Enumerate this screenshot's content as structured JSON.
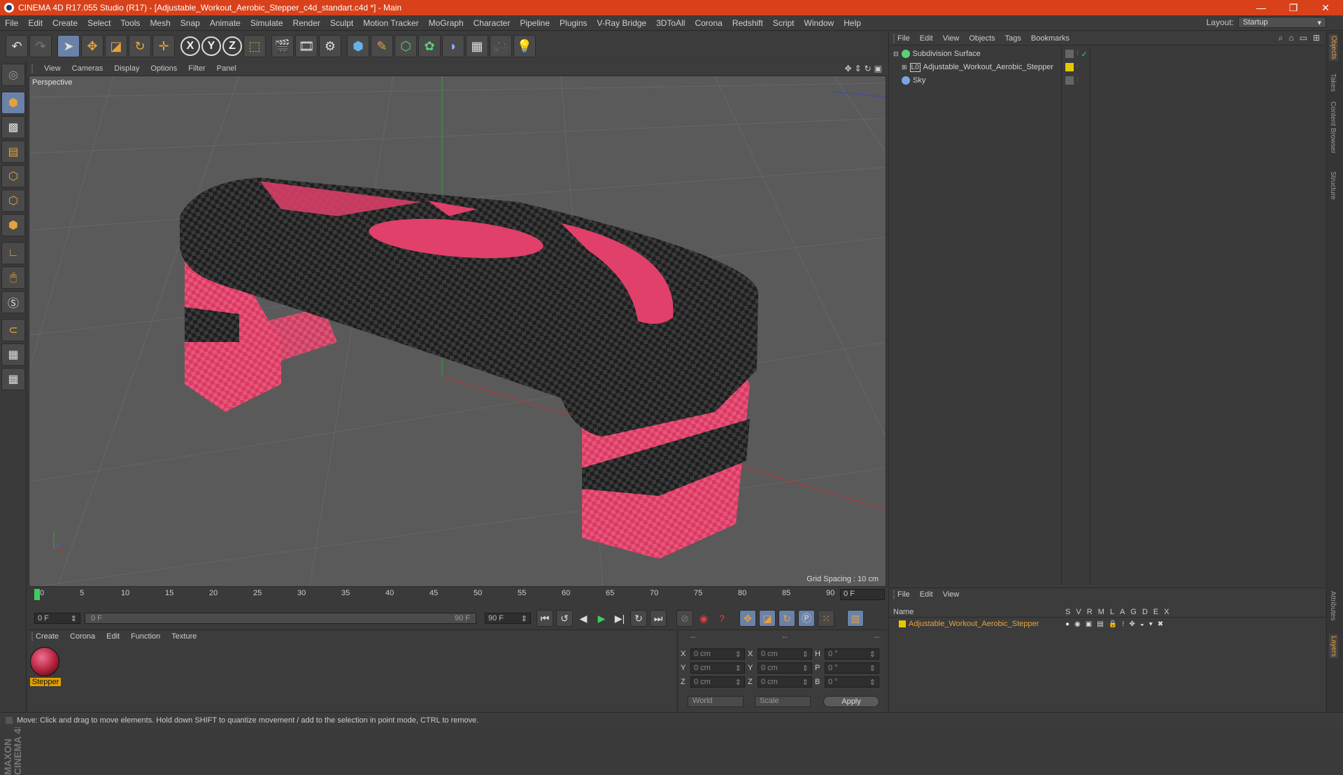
{
  "window": {
    "title": "CINEMA 4D R17.055 Studio (R17) - [Adjustable_Workout_Aerobic_Stepper_c4d_standart.c4d *] - Main",
    "minimize": "—",
    "restore": "❐",
    "close": "✕"
  },
  "menubar": {
    "items": [
      "File",
      "Edit",
      "Create",
      "Select",
      "Tools",
      "Mesh",
      "Snap",
      "Animate",
      "Simulate",
      "Render",
      "Sculpt",
      "Motion Tracker",
      "MoGraph",
      "Character",
      "Pipeline",
      "Plugins",
      "V-Ray Bridge",
      "3DToAll",
      "Corona",
      "Redshift",
      "Script",
      "Window",
      "Help"
    ],
    "layout_label": "Layout:",
    "layout_value": "Startup"
  },
  "viewport": {
    "menu": [
      "View",
      "Cameras",
      "Display",
      "Options",
      "Filter",
      "Panel"
    ],
    "label": "Perspective",
    "grid_spacing": "Grid Spacing : 10 cm"
  },
  "timeline": {
    "ticks": [
      "0",
      "5",
      "10",
      "15",
      "20",
      "25",
      "30",
      "35",
      "40",
      "45",
      "50",
      "55",
      "60",
      "65",
      "70",
      "75",
      "80",
      "85",
      "90"
    ],
    "current_frame": "0 F",
    "start": "0 F",
    "range_start": "0 F",
    "range_end": "90 F",
    "end": "90 F"
  },
  "materials": {
    "menu": [
      "Create",
      "Corona",
      "Edit",
      "Function",
      "Texture"
    ],
    "items": [
      {
        "name": "Stepper"
      }
    ]
  },
  "coordinates": {
    "headers": [
      "--",
      "--",
      "--"
    ],
    "rows": [
      {
        "a": "X",
        "av": "0 cm",
        "b": "X",
        "bv": "0 cm",
        "c": "H",
        "cv": "0 °"
      },
      {
        "a": "Y",
        "av": "0 cm",
        "b": "Y",
        "bv": "0 cm",
        "c": "P",
        "cv": "0 °"
      },
      {
        "a": "Z",
        "av": "0 cm",
        "b": "Z",
        "bv": "0 cm",
        "c": "B",
        "cv": "0 °"
      }
    ],
    "mode1": "World",
    "mode2": "Scale",
    "apply": "Apply"
  },
  "objects": {
    "menu": [
      "File",
      "Edit",
      "View",
      "Objects",
      "Tags",
      "Bookmarks"
    ],
    "items": [
      {
        "name": "Subdivision Surface"
      },
      {
        "name": "Adjustable_Workout_Aerobic_Stepper"
      },
      {
        "name": "Sky"
      }
    ]
  },
  "layers": {
    "menu": [
      "File",
      "Edit",
      "View"
    ],
    "header_name": "Name",
    "flags": [
      "S",
      "V",
      "R",
      "M",
      "L",
      "A",
      "G",
      "D",
      "E",
      "X"
    ],
    "items": [
      {
        "name": "Adjustable_Workout_Aerobic_Stepper",
        "color": "#e6c800"
      }
    ]
  },
  "sidetabs": [
    "Objects",
    "Takes",
    "Content Browser",
    "Structure",
    "Attributes",
    "Layers"
  ],
  "status": "Move: Click and drag to move elements. Hold down SHIFT to quantize movement / add to the selection in point mode, CTRL to remove.",
  "logo": "MAXON CINEMA 4D",
  "colors": {
    "accent": "#d9411a",
    "highlight": "#e6a23c",
    "model_pink": "#e0406a"
  }
}
